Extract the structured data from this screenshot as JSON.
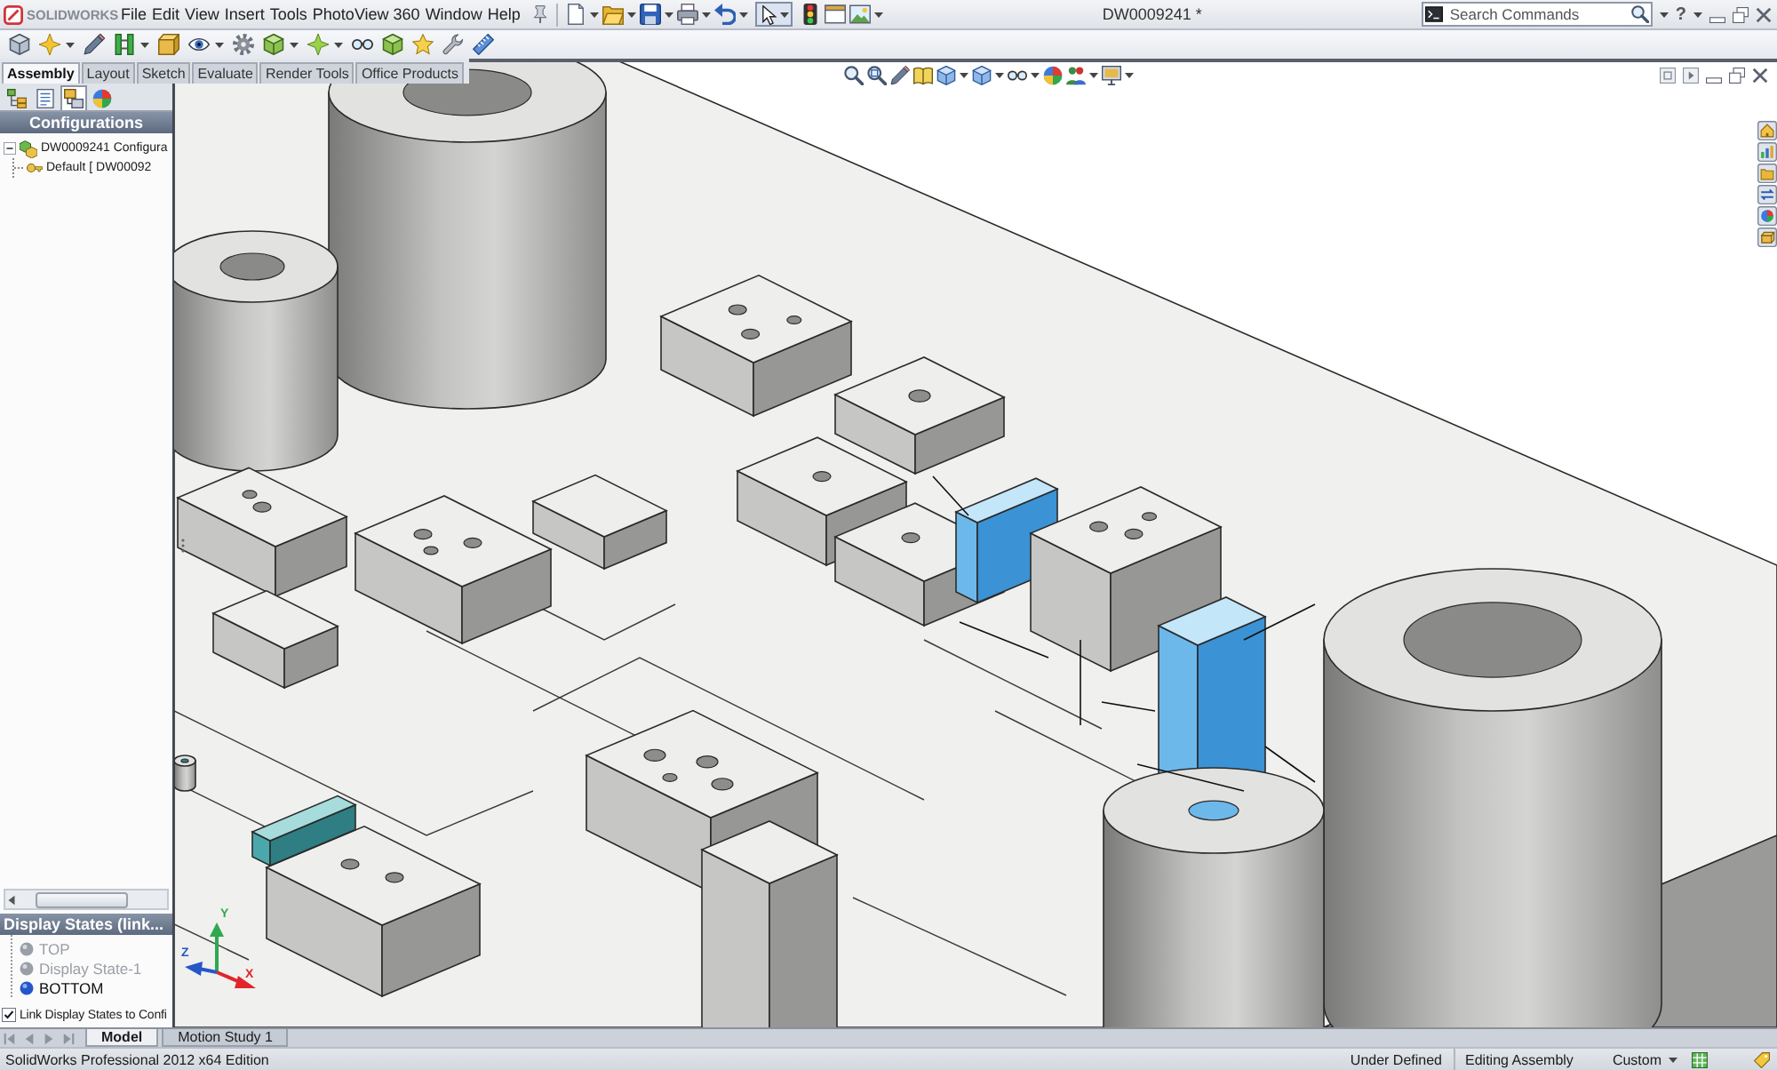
{
  "title_bar": {
    "logo": "SOLIDWORKS",
    "menu": [
      "File",
      "Edit",
      "View",
      "Insert",
      "Tools",
      "PhotoView 360",
      "Window",
      "Help"
    ],
    "document_title": "DW0009241 *",
    "search": {
      "placeholder": "Search Commands"
    },
    "help_glyph": "?"
  },
  "command_tabs": [
    {
      "label": "Assembly",
      "selected": true
    },
    {
      "label": "Layout",
      "selected": false
    },
    {
      "label": "Sketch",
      "selected": false
    },
    {
      "label": "Evaluate",
      "selected": false
    },
    {
      "label": "Render Tools",
      "selected": false
    },
    {
      "label": "Office Products",
      "selected": false
    }
  ],
  "feature_manager": {
    "panel_tabs": [
      {
        "selected": false
      },
      {
        "selected": false
      },
      {
        "selected": true
      },
      {
        "selected": false
      }
    ],
    "header": "Configurations",
    "tree": [
      {
        "label": "DW0009241 Configura",
        "expanded": true,
        "children": [
          {
            "label": "Default [ DW00092"
          }
        ]
      }
    ]
  },
  "display_states": {
    "header": "Display States (link...",
    "items": [
      {
        "label": "TOP",
        "selected": false
      },
      {
        "label": "Display State-1",
        "selected": false
      },
      {
        "label": "BOTTOM",
        "selected": true
      }
    ],
    "link_option": {
      "label": "Link Display States to Confi",
      "checked": true
    }
  },
  "triad": {
    "x_label": "X",
    "y_label": "Y",
    "z_label": "Z"
  },
  "bottom_tabs": [
    {
      "label": "Model",
      "selected": true
    },
    {
      "label": "Motion Study 1",
      "selected": false
    }
  ],
  "status_bar": {
    "edition": "SolidWorks Professional 2012 x64 Edition",
    "sketch_state": "Under Defined",
    "mode": "Editing Assembly",
    "units": "Custom"
  }
}
